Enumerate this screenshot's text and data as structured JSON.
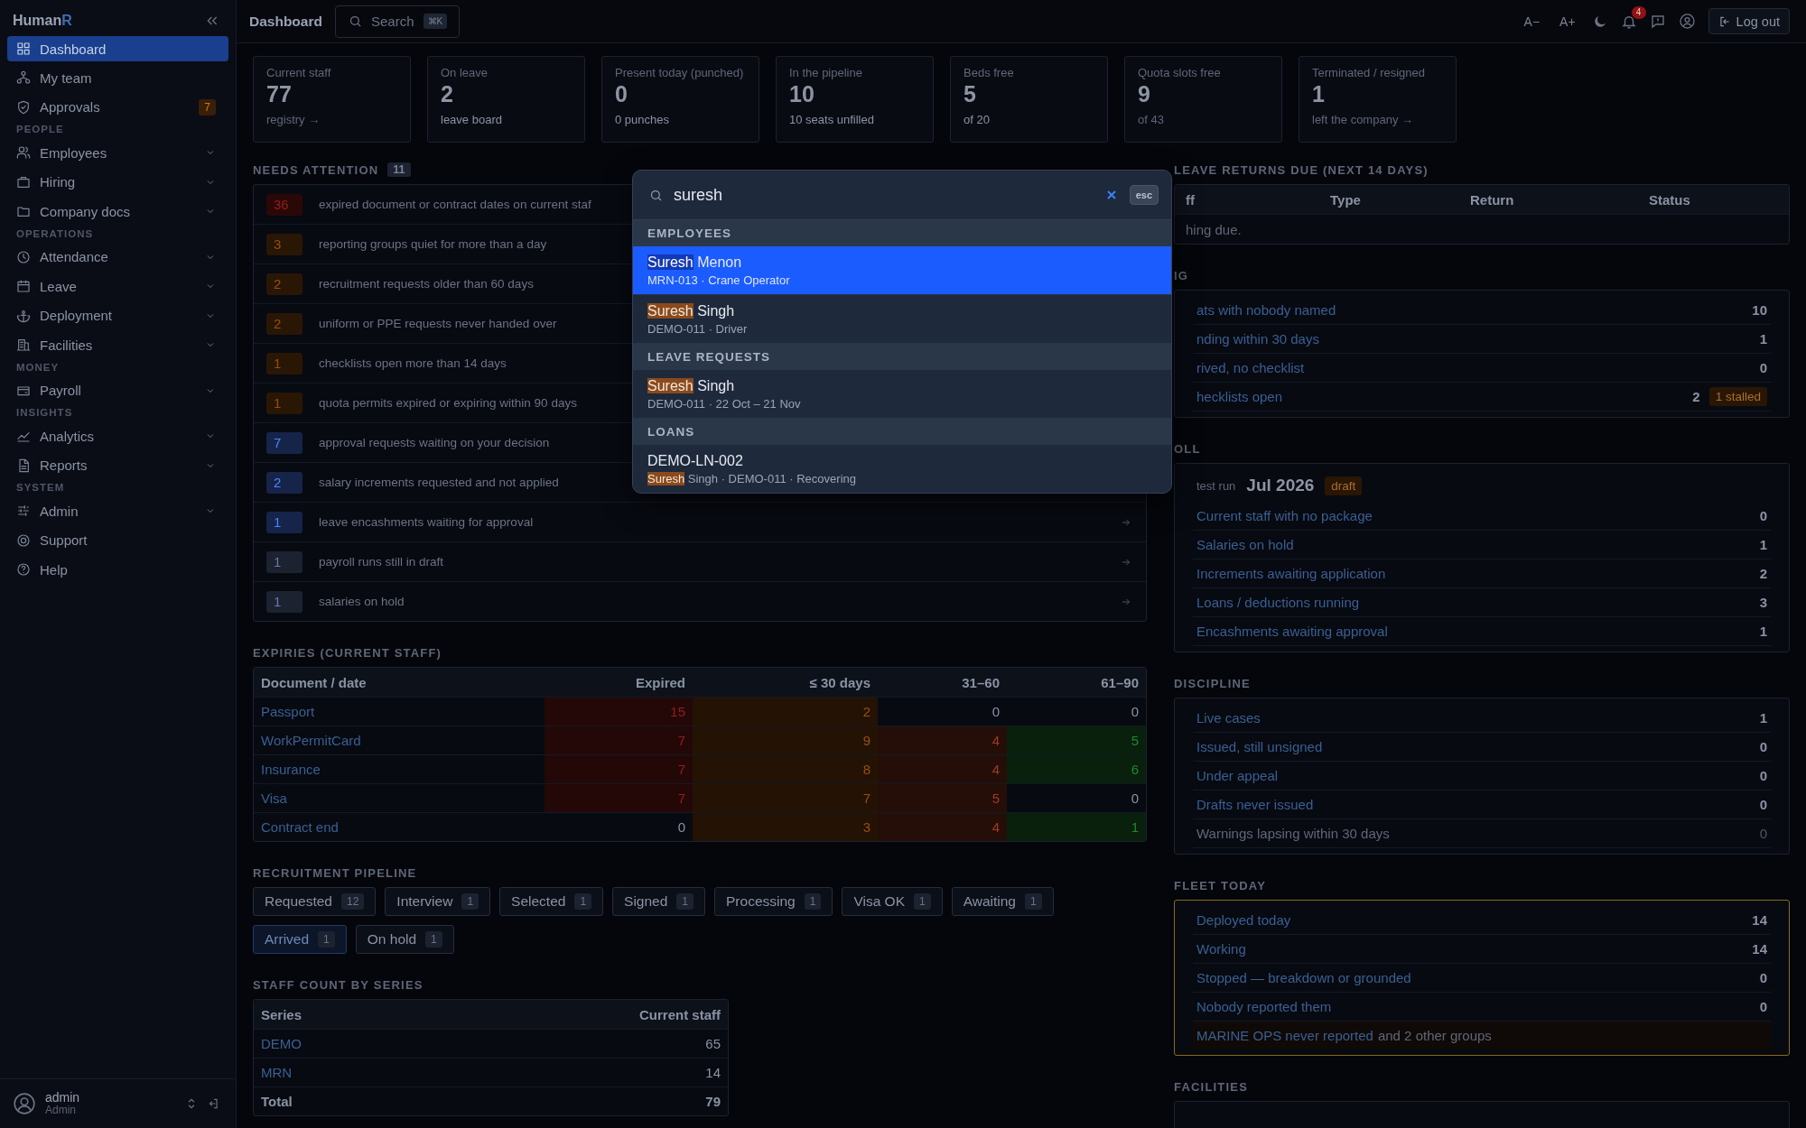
{
  "sidebar": {
    "brand": "Human",
    "brand_accent": "R",
    "sections": [
      {
        "items": [
          {
            "label": "Dashboard",
            "selected": true,
            "expandable": false
          },
          {
            "label": "My team",
            "selected": false,
            "expandable": false
          },
          {
            "label": "Approvals",
            "selected": false,
            "expandable": false,
            "badge": "7"
          }
        ]
      },
      {
        "heading": "PEOPLE",
        "items": [
          {
            "label": "Employees",
            "selected": false,
            "expandable": true
          },
          {
            "label": "Hiring",
            "selected": false,
            "expandable": true
          },
          {
            "label": "Company docs",
            "selected": false,
            "expandable": true
          }
        ]
      },
      {
        "heading": "OPERATIONS",
        "items": [
          {
            "label": "Attendance",
            "selected": false,
            "expandable": true
          },
          {
            "label": "Leave",
            "selected": false,
            "expandable": true
          },
          {
            "label": "Deployment",
            "selected": false,
            "expandable": true
          },
          {
            "label": "Facilities",
            "selected": false,
            "expandable": true
          }
        ]
      },
      {
        "heading": "MONEY",
        "items": [
          {
            "label": "Payroll",
            "selected": false,
            "expandable": true
          }
        ]
      },
      {
        "heading": "INSIGHTS",
        "items": [
          {
            "label": "Analytics",
            "selected": false,
            "expandable": true
          },
          {
            "label": "Reports",
            "selected": false,
            "expandable": true
          }
        ]
      },
      {
        "heading": "SYSTEM",
        "items": [
          {
            "label": "Admin",
            "selected": false,
            "expandable": true
          },
          {
            "label": "Support",
            "selected": false,
            "expandable": false
          },
          {
            "label": "Help",
            "selected": false,
            "expandable": false
          }
        ]
      }
    ],
    "user": {
      "name": "admin",
      "role": "Admin"
    }
  },
  "topbar": {
    "title": "Dashboard",
    "search": {
      "placeholder": "Search",
      "shortcut": "⌘K"
    },
    "font_smaller": "A−",
    "font_larger": "A+",
    "notifications": "4",
    "logout": "Log out"
  },
  "stats": [
    {
      "label": "Current staff",
      "value": "77",
      "sub": "registry →",
      "muted": true
    },
    {
      "label": "On leave",
      "value": "2",
      "sub": "leave board",
      "muted": false
    },
    {
      "label": "Present today (punched)",
      "value": "0",
      "sub": "0 punches",
      "muted": false
    },
    {
      "label": "In the pipeline",
      "value": "10",
      "sub": "10 seats unfilled",
      "muted": false
    },
    {
      "label": "Beds free",
      "value": "5",
      "sub": "of 20",
      "muted": false
    },
    {
      "label": "Quota slots free",
      "value": "9",
      "sub": "of 43",
      "muted": true
    },
    {
      "label": "Terminated / resigned",
      "value": "1",
      "sub": "left the company →",
      "muted": true
    }
  ],
  "needs_attention": {
    "title": "NEEDS ATTENTION",
    "count": "11",
    "items": [
      {
        "count": "36",
        "text": "expired document or contract dates on current staf",
        "color": "#2a0808",
        "arrow": false
      },
      {
        "count": "3",
        "text": "reporting groups quiet for more than a day",
        "color": "#2a1604",
        "arrow": false
      },
      {
        "count": "2",
        "text": "recruitment requests older than 60 days",
        "color": "#2a1604",
        "arrow": false
      },
      {
        "count": "2",
        "text": "uniform or PPE requests never handed over",
        "color": "#2a1604",
        "arrow": false
      },
      {
        "count": "1",
        "text": "checklists open more than 14 days",
        "color": "#2a1604",
        "arrow": false
      },
      {
        "count": "1",
        "text": "quota permits expired or expiring within 90 days",
        "color": "#2a1604",
        "arrow": false
      },
      {
        "count": "7",
        "text": "approval requests waiting on your decision",
        "color": "#16244a",
        "arrow": false
      },
      {
        "count": "2",
        "text": "salary increments requested and not applied",
        "color": "#16244a",
        "arrow": false
      },
      {
        "count": "1",
        "text": "leave encashments waiting for approval",
        "color": "#16244a",
        "arrow": true
      },
      {
        "count": "1",
        "text": "payroll runs still in draft",
        "color": "#1c2230",
        "arrow": true
      },
      {
        "count": "1",
        "text": "salaries on hold",
        "color": "#1c2230",
        "arrow": true
      }
    ]
  },
  "expiries": {
    "title": "EXPIRIES (CURRENT STAFF)",
    "columns": [
      "Document / date",
      "Expired",
      "≤ 30 days",
      "31–60",
      "61–90"
    ],
    "rows": [
      {
        "cells": [
          {
            "value": "Passport"
          },
          {
            "value": "15",
            "color": "#240707"
          },
          {
            "value": "2",
            "color": "#241304"
          },
          {
            "value": "0"
          },
          {
            "value": "0"
          }
        ]
      },
      {
        "cells": [
          {
            "value": "WorkPermitCard"
          },
          {
            "value": "7",
            "color": "#240707"
          },
          {
            "value": "9",
            "color": "#241304"
          },
          {
            "value": "4",
            "color": "#260e08"
          },
          {
            "value": "5",
            "color": "#08200c"
          }
        ]
      },
      {
        "cells": [
          {
            "value": "Insurance"
          },
          {
            "value": "7",
            "color": "#240707"
          },
          {
            "value": "8",
            "color": "#241304"
          },
          {
            "value": "4",
            "color": "#260e08"
          },
          {
            "value": "6",
            "color": "#08200c"
          }
        ]
      },
      {
        "cells": [
          {
            "value": "Visa"
          },
          {
            "value": "7",
            "color": "#240707"
          },
          {
            "value": "7",
            "color": "#241304"
          },
          {
            "value": "5",
            "color": "#260e08"
          },
          {
            "value": "0"
          }
        ]
      },
      {
        "cells": [
          {
            "value": "Contract end"
          },
          {
            "value": "0"
          },
          {
            "value": "3",
            "color": "#241304"
          },
          {
            "value": "4",
            "color": "#260e08"
          },
          {
            "value": "1",
            "color": "#08200c"
          }
        ]
      }
    ]
  },
  "pipeline": {
    "title": "RECRUITMENT PIPELINE",
    "stages": [
      {
        "label": "Requested",
        "count": "12",
        "selected": false
      },
      {
        "label": "Interview",
        "count": "1",
        "selected": false
      },
      {
        "label": "Selected",
        "count": "1",
        "selected": false
      },
      {
        "label": "Signed",
        "count": "1",
        "selected": false
      },
      {
        "label": "Processing",
        "count": "1",
        "selected": false
      },
      {
        "label": "Visa OK",
        "count": "1",
        "selected": false
      },
      {
        "label": "Awaiting",
        "count": "1",
        "selected": false
      },
      {
        "label": "Arrived",
        "count": "1",
        "selected": true
      },
      {
        "label": "On hold",
        "count": "1",
        "selected": false
      }
    ]
  },
  "series": {
    "title": "STAFF COUNT BY SERIES",
    "columns": [
      "Series",
      "Current staff"
    ],
    "rows": [
      {
        "series": "DEMO",
        "count": "65",
        "total": false
      },
      {
        "series": "MRN",
        "count": "14",
        "total": false
      },
      {
        "series": "Total",
        "count": "79",
        "total": true
      }
    ]
  },
  "leave_returns": {
    "title": "LEAVE RETURNS DUE (NEXT 14 DAYS)",
    "columns": [
      "ff",
      "Type",
      "Return",
      "Status"
    ],
    "empty": "hing due."
  },
  "hiring": {
    "title": "IG",
    "rows": [
      {
        "label": "ats with nobody named",
        "value": "10",
        "muted": false
      },
      {
        "label": "nding within 30 days",
        "value": "1",
        "muted": false
      },
      {
        "label": "rived, no checklist",
        "value": "0",
        "muted": false
      },
      {
        "label": "hecklists open",
        "value": "2",
        "muted": false,
        "badge": "1 stalled"
      }
    ]
  },
  "payroll": {
    "title": "OLL",
    "run_label": "test run",
    "run_period": "Jul 2026",
    "run_status": "draft",
    "rows": [
      {
        "label": "Current staff with no package",
        "value": "0",
        "muted": false
      },
      {
        "label": "Salaries on hold",
        "value": "1",
        "muted": false
      },
      {
        "label": "Increments awaiting application",
        "value": "2",
        "muted": false
      },
      {
        "label": "Loans / deductions running",
        "value": "3",
        "muted": false
      },
      {
        "label": "Encashments awaiting approval",
        "value": "1",
        "muted": false
      }
    ]
  },
  "discipline": {
    "title": "DISCIPLINE",
    "rows": [
      {
        "label": "Live cases",
        "value": "1",
        "muted": false
      },
      {
        "label": "Issued, still unsigned",
        "value": "0",
        "muted": false
      },
      {
        "label": "Under appeal",
        "value": "0",
        "muted": false
      },
      {
        "label": "Drafts never issued",
        "value": "0",
        "muted": false
      },
      {
        "label": "Warnings lapsing within 30 days",
        "value": "0",
        "muted": true
      }
    ]
  },
  "fleet": {
    "title": "FLEET TODAY",
    "alert": true,
    "rows": [
      {
        "label": "Deployed today",
        "value": "14",
        "muted": false
      },
      {
        "label": "Working",
        "value": "14",
        "muted": false
      },
      {
        "label": "Stopped — breakdown or grounded",
        "value": "0",
        "muted": false
      },
      {
        "label": "Nobody reported them",
        "value": "0",
        "muted": false
      }
    ],
    "note": {
      "link": "MARINE OPS never reported",
      "rest": "and 2 other groups"
    }
  },
  "facilities": {
    "title": "FACILITIES"
  },
  "search_modal": {
    "query": "suresh",
    "esc": "esc",
    "groups": [
      {
        "heading": "EMPLOYEES",
        "results": [
          {
            "selected": true,
            "title": "**Suresh** Menon",
            "subtitle": "MRN-013 · Crane Operator"
          },
          {
            "selected": false,
            "title": "**Suresh** Singh",
            "subtitle": "DEMO-011 · Driver"
          }
        ]
      },
      {
        "heading": "LEAVE REQUESTS",
        "results": [
          {
            "selected": false,
            "title": "**Suresh** Singh",
            "subtitle": "DEMO-011 · 22 Oct – 21 Nov"
          }
        ]
      },
      {
        "heading": "LOANS",
        "results": [
          {
            "selected": false,
            "title": "DEMO-LN-002",
            "subtitle": "**Suresh** Singh · DEMO-011 · Recovering"
          }
        ]
      }
    ]
  }
}
